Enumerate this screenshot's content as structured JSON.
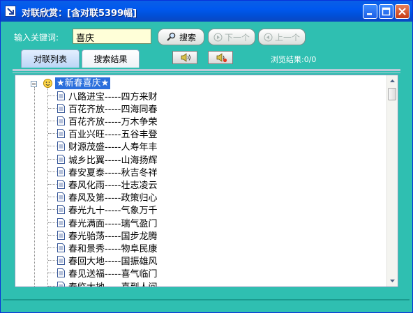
{
  "window": {
    "title": "对联欣赏：[含对联5399幅]"
  },
  "search": {
    "label": "输入关键词:",
    "value": "喜庆",
    "search_button": "搜索",
    "next_button": "下一个",
    "prev_button": "上一个"
  },
  "tabs": {
    "list_tab": "对联列表",
    "result_tab": "搜索结果"
  },
  "browse_result": "浏览结果:0/0",
  "tree": {
    "root_label": "★新春喜庆★",
    "items": [
      "八路进宝-----四方来财",
      "百花齐放-----四海同春",
      "百花齐放-----万木争荣",
      "百业兴旺-----五谷丰登",
      "财源茂盛-----人寿年丰",
      "城乡比翼-----山海扬辉",
      "春安夏泰-----秋吉冬祥",
      "春风化雨-----壮志凌云",
      "春风及第-----政策归心",
      "春光九十-----气象万千",
      "春光满面-----瑞气盈门",
      "春光骀荡-----国步龙腾",
      "春和景秀-----物阜民康",
      "春回大地-----国振雄风",
      "春见送福-----喜气临门",
      "春临大地-----喜到人间"
    ]
  },
  "colors": {
    "window_bg": "#2fbfb1",
    "titlebar": "#0058ee",
    "selected_root": "#2b6fdc",
    "input_bg": "#ffffd8"
  },
  "icons": {
    "app": "arrow-icon",
    "search": "magnifier-icon",
    "next": "play-next-icon",
    "prev": "play-prev-icon",
    "speaker_on": "speaker-icon",
    "speaker_off": "speaker-mute-icon",
    "root": "smiley-icon",
    "item": "document-icon"
  }
}
